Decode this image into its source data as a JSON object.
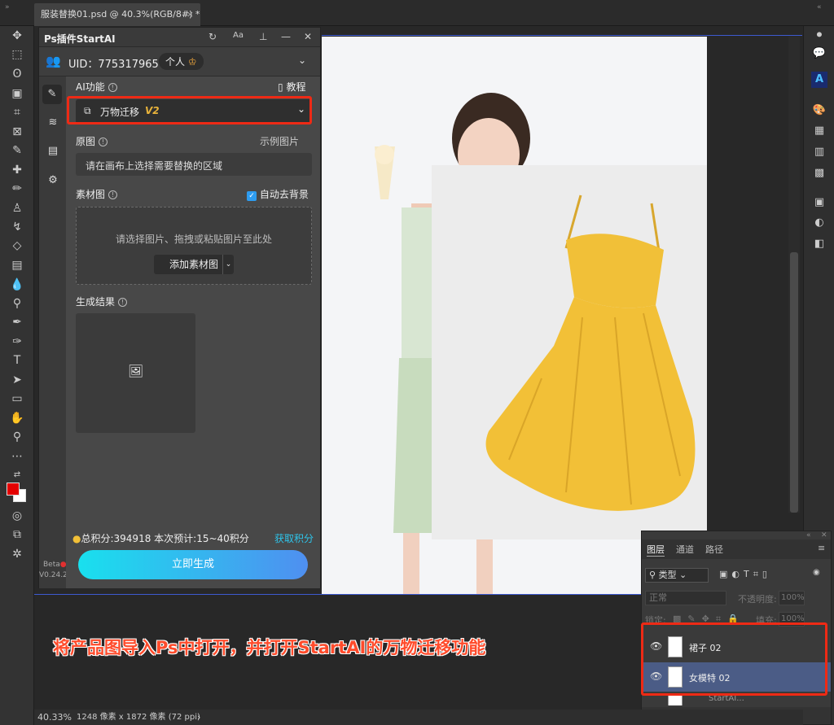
{
  "document": {
    "tab_title": "服装替换01.psd @ 40.3%(RGB/8#) *",
    "close": "×"
  },
  "plugin": {
    "title": "Ps插件StartAI",
    "header_icons": [
      "refresh-icon",
      "font-size-icon",
      "pin-icon",
      "minimize-icon",
      "close-icon"
    ],
    "uid": "UID：775317965",
    "account_type": "个人",
    "ai_function_label": "AI功能",
    "tutorial_link": "教程",
    "selected_function": "万物迁移",
    "function_version": "V2",
    "original_label": "原图",
    "example_link": "示例图片",
    "original_placeholder": "请在画布上选择需要替换的区域",
    "material_label": "素材图",
    "auto_remove_bg": "自动去背景",
    "auto_remove_bg_checked": true,
    "dropzone_text": "请选择图片、拖拽或粘贴图片至此处",
    "add_material_button": "添加素材图",
    "result_label": "生成结果",
    "total_points": "总积分:394918",
    "estimate": "本次预计:15~40积分",
    "get_points_link": "获取积分",
    "generate_button": "立即生成",
    "beta_label": "Beta",
    "version": "V0.24.2"
  },
  "layers_panel": {
    "tabs": [
      "图层",
      "通道",
      "路径"
    ],
    "filter_label": "类型",
    "blend_mode": "正常",
    "opacity_label": "不透明度:",
    "opacity_value": "100%",
    "lock_label": "锁定:",
    "fill_label": "填充:",
    "fill_value": "100%",
    "layers": [
      {
        "name": "裙子 02",
        "visible": true,
        "selected": false
      },
      {
        "name": "女模特 02",
        "visible": true,
        "selected": true
      },
      {
        "name": "StartAI...",
        "visible": false,
        "selected": false
      }
    ]
  },
  "caption": "将产品图导入Ps中打开，并打开StartAI的万物迁移功能",
  "status": {
    "zoom": "40.33%",
    "doc_size": "1248 像素 x 1872 像素 (72 ppi)",
    "arrow": "›"
  },
  "colors": {
    "foreground": "#e40000",
    "background": "#ffffff",
    "accent_highlight": "#ee2a15",
    "dress": "#f2c037"
  }
}
